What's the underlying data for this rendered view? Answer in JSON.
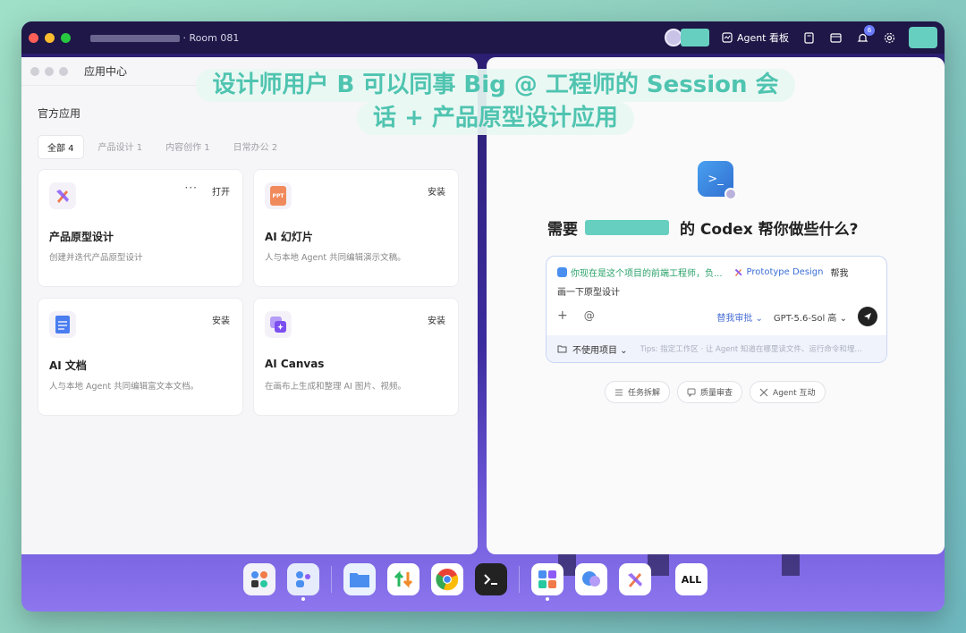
{
  "topbar": {
    "room": "Room 081",
    "agent_board": "Agent 看板",
    "notification_count": "6"
  },
  "caption": {
    "line1": "设计师用户 B 可以同事 Big @ 工程师的 Session 会",
    "line2": "话 + 产品原型设计应用"
  },
  "app_center": {
    "window_title": "应用中心",
    "section_title": "官方应用",
    "tabs": [
      {
        "label": "全部 4"
      },
      {
        "label": "产品设计 1"
      },
      {
        "label": "内容创作 1"
      },
      {
        "label": "日常办公 2"
      }
    ],
    "cards": [
      {
        "title": "产品原型设计",
        "desc": "创建并迭代产品原型设计",
        "action": "打开",
        "more": "···",
        "icon": "prototype-design-icon"
      },
      {
        "title": "AI 幻灯片",
        "desc": "人与本地 Agent 共同编辑演示文稿。",
        "action": "安装",
        "icon": "ppt-icon",
        "icon_text": "PPT"
      },
      {
        "title": "AI 文档",
        "desc": "人与本地 Agent 共同编辑富文本文档。",
        "action": "安装",
        "icon": "document-icon"
      },
      {
        "title": "AI Canvas",
        "desc": "在画布上生成和整理 AI 图片、视频。",
        "action": "安装",
        "icon": "canvas-icon"
      }
    ]
  },
  "codex": {
    "logo_text": ">_",
    "hero_prefix": "需要",
    "hero_suffix": "的 Codex 帮你做些什么?",
    "chip_session": "你现在是这个项目的前端工程师，负...",
    "chip_app": "Prototype Design",
    "chip_tail": "帮我",
    "draft": "画一下原型设计",
    "add": "+",
    "mention": "@",
    "review": "替我审批 ⌄",
    "model": "GPT-5.6-Sol  高 ⌄",
    "project": "不使用项目 ⌄",
    "tips": "Tips: 指定工作区 · 让 Agent 知道在哪里读文件、运行命令和埋...",
    "quick": [
      {
        "label": "任务拆解"
      },
      {
        "label": "质量审查"
      },
      {
        "label": "Agent 互动"
      }
    ]
  },
  "dock": {
    "all_label": "ALL"
  },
  "colors": {
    "accent_teal": "#66cfc0",
    "topbar": "#1e1747",
    "link_blue": "#3b6fd6"
  }
}
